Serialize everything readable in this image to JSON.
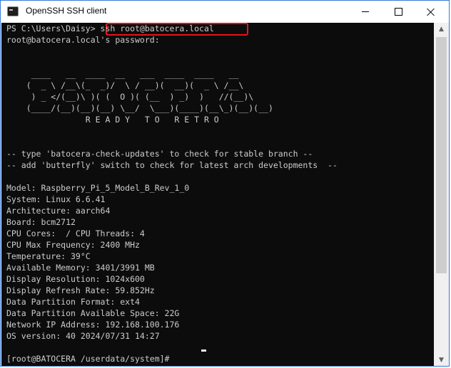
{
  "window": {
    "title": "OpenSSH SSH client",
    "minimize_label": "—",
    "maximize_label": "☐",
    "close_label": "✕"
  },
  "console": {
    "lines": [
      "PS C:\\Users\\Daisy> ssh root@batocera.local",
      "root@batocera.local's password:",
      "",
      "",
      "     ____   __  ____  __   ___  ____  ____   __",
      "    (  _ \\ /__\\(_  _)/  \\ / __)(  __)(  _ \\ /__\\",
      "     ) _ </(__)\\ )( (  O )( (__  ) _)  )   //(__)\\",
      "    (____/(__)(__)(__) \\__/  \\___)(____)(__\\_)(__)(__)",
      "                R E A D Y   T O   R E T R O",
      "",
      "",
      "-- type 'batocera-check-updates' to check for stable branch --",
      "-- add 'butterfly' switch to check for latest arch developments  --",
      "",
      "Model: Raspberry_Pi_5_Model_B_Rev_1_0",
      "System: Linux 6.6.41",
      "Architecture: aarch64",
      "Board: bcm2712",
      "CPU Cores:  / CPU Threads: 4",
      "CPU Max Frequency: 2400 MHz",
      "Temperature: 39°C",
      "Available Memory: 3401/3991 MB",
      "Display Resolution: 1024x600",
      "Display Refresh Rate: 59.852Hz",
      "Data Partition Format: ext4",
      "Data Partition Available Space: 22G",
      "Network IP Address: 192.168.100.176",
      "OS version: 40 2024/07/31 14:27",
      "",
      "[root@BATOCERA /userdata/system]#"
    ],
    "highlighted_command": "ssh root@batocera.local",
    "highlight_color": "#e8141b",
    "background_color": "#0c0c0c",
    "text_color": "#cccccc"
  },
  "scrollbar": {
    "up_arrow": "▲",
    "down_arrow": "▼"
  }
}
